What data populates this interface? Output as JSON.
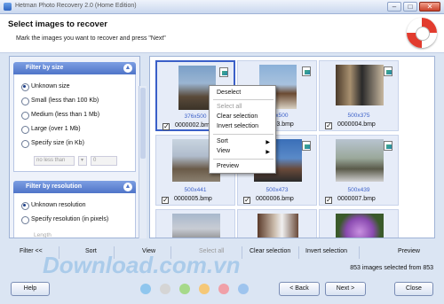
{
  "window": {
    "title": "Hetman Photo Recovery 2.0 (Home Edition)"
  },
  "header": {
    "title": "Select images to recover",
    "subtitle": "Mark the images you want to recover and press \"Next\""
  },
  "filter_size": {
    "title": "Filter by size",
    "options": [
      "Unknown size",
      "Small (less than 100 Kb)",
      "Medium (less than 1 Mb)",
      "Large (over 1 Mb)",
      "Specify size (in Kb)"
    ],
    "selected": "Unknown size",
    "less_than_label": "no less than",
    "value": "0"
  },
  "filter_resolution": {
    "title": "Filter by resolution",
    "options": [
      "Unknown resolution",
      "Specify resolution (in pixels)"
    ],
    "selected": "Unknown resolution",
    "length_label": "Length"
  },
  "thumbnails": [
    {
      "name": "0000002.bmp",
      "dims": "376x500",
      "checked": true,
      "selected": true
    },
    {
      "name": "0000003.bmp",
      "dims": "375x500",
      "checked": true,
      "selected": false
    },
    {
      "name": "0000004.bmp",
      "dims": "500x375",
      "checked": true,
      "selected": false
    },
    {
      "name": "0000005.bmp",
      "dims": "500x441",
      "checked": true,
      "selected": false
    },
    {
      "name": "0000006.bmp",
      "dims": "500x473",
      "checked": true,
      "selected": false
    },
    {
      "name": "0000007.bmp",
      "dims": "500x439",
      "checked": true,
      "selected": false
    }
  ],
  "context_menu": {
    "deselect": "Deselect",
    "select_all": "Select all",
    "clear_selection": "Clear selection",
    "invert_selection": "Invert selection",
    "sort": "Sort",
    "view": "View",
    "preview": "Preview"
  },
  "toolbar": {
    "filter": "Filter <<",
    "sort": "Sort",
    "view": "View",
    "select_all": "Select all",
    "clear_selection": "Clear selection",
    "invert_selection": "Invert selection",
    "preview": "Preview"
  },
  "status": "853 images selected from 853",
  "watermark": "Download.com.vn",
  "buttons": {
    "help": "Help",
    "back": "< Back",
    "next": "Next >",
    "close": "Close"
  },
  "dots": [
    "#8fc6ee",
    "#d5d5d5",
    "#a6d98a",
    "#f5c878",
    "#f0a0a8",
    "#9ec4ee"
  ],
  "colors": {
    "accent": "#4f74c8",
    "selection": "#3a5fc8"
  }
}
